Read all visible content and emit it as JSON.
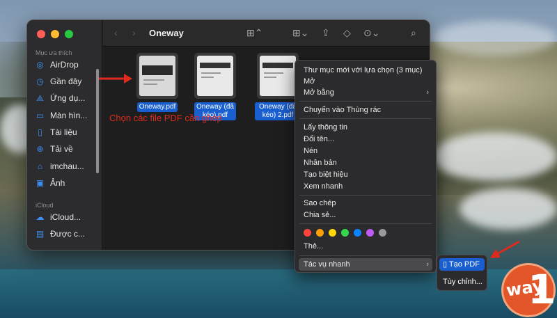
{
  "finder": {
    "title": "Oneway",
    "sidebar": {
      "favorites_header": "Mục ưa thích",
      "items": [
        {
          "label": "AirDrop",
          "icon": "airdrop-icon"
        },
        {
          "label": "Gần đây",
          "icon": "clock-icon"
        },
        {
          "label": "Ứng dụ...",
          "icon": "applications-icon"
        },
        {
          "label": "Màn hìn...",
          "icon": "desktop-icon"
        },
        {
          "label": "Tài liệu",
          "icon": "document-icon"
        },
        {
          "label": "Tải về",
          "icon": "download-icon"
        },
        {
          "label": "imchau...",
          "icon": "home-icon"
        },
        {
          "label": "Ảnh",
          "icon": "photos-icon"
        }
      ],
      "icloud_header": "iCloud",
      "icloud_items": [
        {
          "label": "iCloud...",
          "icon": "cloud-icon"
        },
        {
          "label": "Được c...",
          "icon": "shared-folder-icon"
        }
      ]
    },
    "files": [
      {
        "name": "Oneway.pdf"
      },
      {
        "name": "Oneway (đã kéo).pdf"
      },
      {
        "name": "Oneway (đã kéo) 2.pdf"
      }
    ]
  },
  "annotation": "Chọn các file PDF cần ghép",
  "context_menu": {
    "items": [
      "Thư mục mới với lựa chọn (3 mục)",
      "Mở",
      "Mở bằng",
      "Chuyển vào Thùng rác",
      "Lấy thông tin",
      "Đổi tên...",
      "Nén",
      "Nhân bản",
      "Tạo biệt hiệu",
      "Xem nhanh",
      "Sao chép",
      "Chia sẻ...",
      "Thẻ...",
      "Tác vụ nhanh"
    ],
    "tag_colors": [
      "#ff453a",
      "#ff9f0a",
      "#ffd60a",
      "#32d74b",
      "#0a84ff",
      "#bf5af2",
      "#98989d"
    ]
  },
  "quick_actions_submenu": {
    "create_pdf": "Tạo PDF",
    "customize": "Tùy chỉnh..."
  },
  "logo": {
    "number": "1",
    "word": "way"
  },
  "colors": {
    "selection": "#1a5fd0",
    "annotation": "#e02a1e"
  }
}
